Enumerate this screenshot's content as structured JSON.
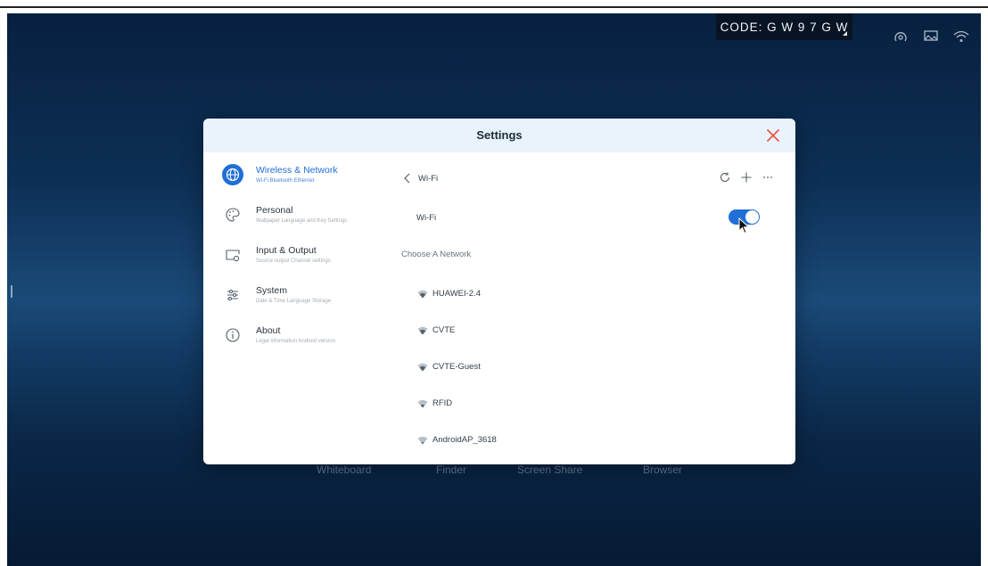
{
  "status_bar": {
    "code_label": "CODE: G W 9 7 G W",
    "icons": [
      "hotspot-icon",
      "screen-cast-icon",
      "wifi-icon"
    ]
  },
  "dock": {
    "apps": [
      "Whiteboard",
      "Finder",
      "Screen Share",
      "Browser"
    ]
  },
  "dialog": {
    "title": "Settings",
    "close_icon": "close-icon",
    "accent_color": "#1f6fd6",
    "close_color": "#e9574d"
  },
  "sidebar": {
    "items": [
      {
        "label": "Wireless & Network",
        "sub": "Wi-Fi Bluetooth Ethernet",
        "icon": "globe-icon",
        "active": true
      },
      {
        "label": "Personal",
        "sub": "Wallpaper Language and Key Settings",
        "icon": "palette-icon",
        "active": false
      },
      {
        "label": "Input & Output",
        "sub": "Source output Channel settings",
        "icon": "input-output-icon",
        "active": false
      },
      {
        "label": "System",
        "sub": "Date & Time Language Storage",
        "icon": "sliders-icon",
        "active": false
      },
      {
        "label": "About",
        "sub": "Legal information Android version",
        "icon": "info-icon",
        "active": false
      }
    ]
  },
  "wifi_page": {
    "title": "Wi-Fi",
    "toggle_label": "Wi-Fi",
    "toggle_on": true,
    "section_label": "Choose A Network",
    "toolbar_icons": [
      "refresh-icon",
      "add-icon",
      "more-icon"
    ],
    "networks": [
      {
        "name": "HUAWEI-2.4"
      },
      {
        "name": "CVTE"
      },
      {
        "name": "CVTE-Guest"
      },
      {
        "name": "RFID"
      },
      {
        "name": "AndroidAP_3618"
      }
    ]
  }
}
